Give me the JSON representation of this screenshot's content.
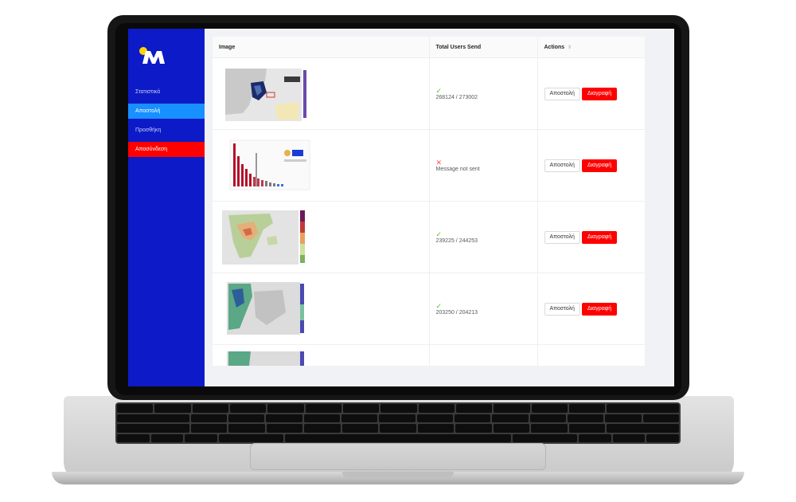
{
  "sidebar": {
    "items": [
      {
        "label": "Στατιστικά"
      },
      {
        "label": "Αποστολή"
      },
      {
        "label": "Προσθήκη"
      },
      {
        "label": "Αποσύνδεση"
      }
    ]
  },
  "table": {
    "headers": {
      "image": "Image",
      "total": "Total Users Send",
      "actions": "Actions"
    },
    "rows": [
      {
        "status": "✓",
        "total": "268124 / 273002"
      },
      {
        "status": "✕",
        "total": "Message not sent"
      },
      {
        "status": "✓",
        "total": "239225 / 244253"
      },
      {
        "status": "✓",
        "total": "203250 / 204213"
      }
    ],
    "send_label": "Αποστολή",
    "delete_label": "Διαγραφή"
  },
  "colors": {
    "sidebar": "#0d1ac7",
    "active": "#1890ff",
    "danger": "#ff0000",
    "success": "#52c41a"
  }
}
